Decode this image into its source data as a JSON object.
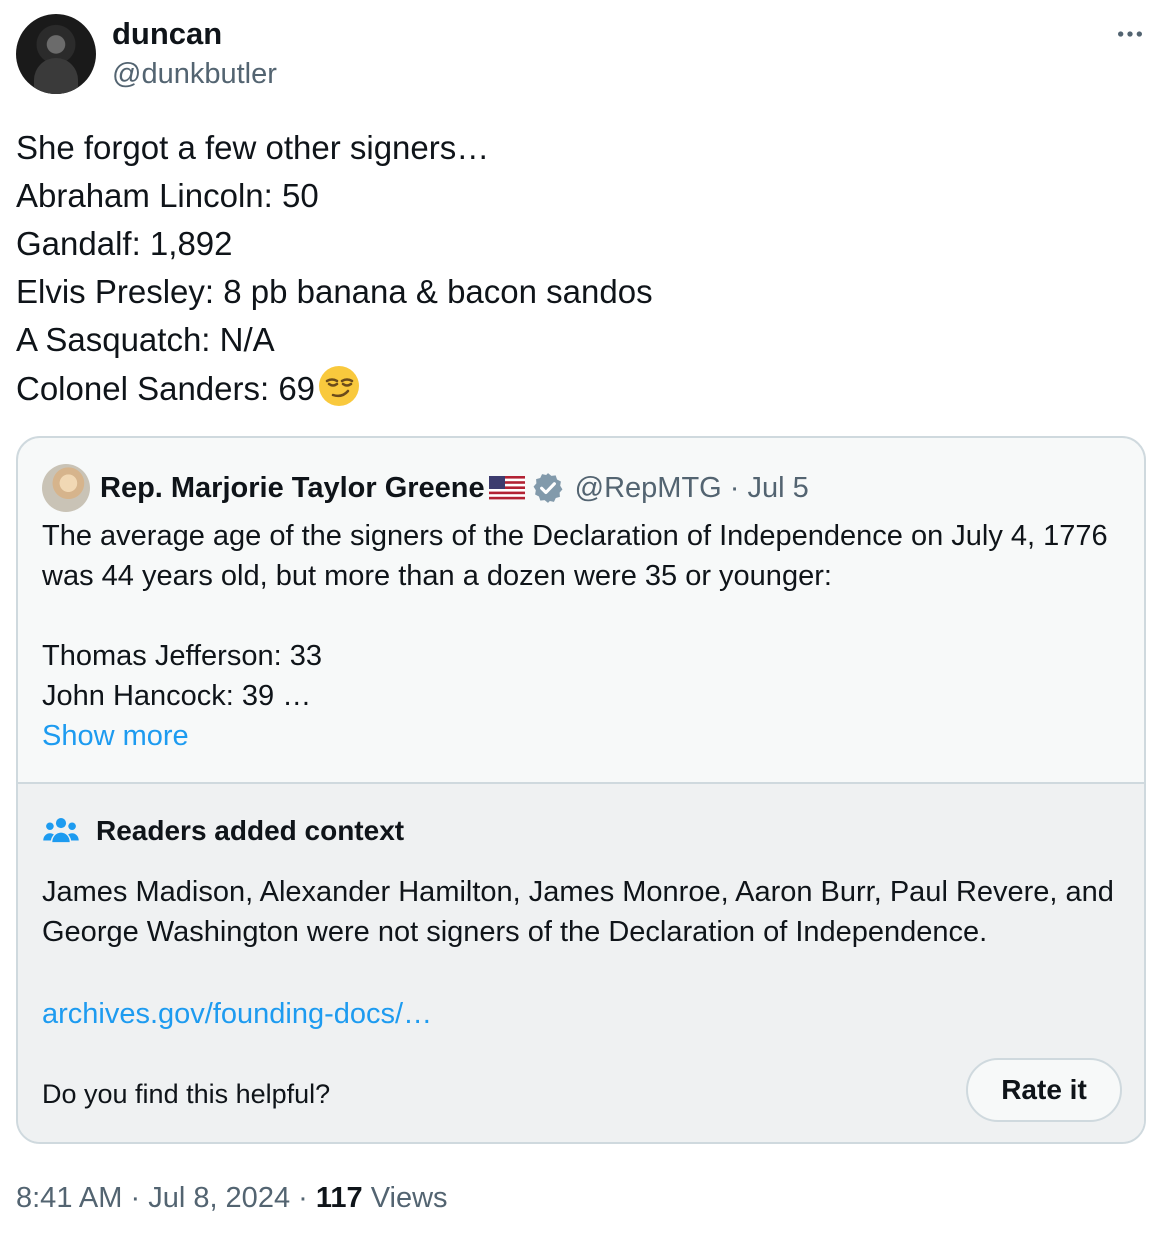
{
  "author": {
    "display_name": "duncan",
    "handle": "@dunkbutler"
  },
  "tweet": {
    "lines": [
      "She forgot a few other signers…",
      "Abraham Lincoln: 50",
      "Gandalf: 1,892",
      "Elvis Presley: 8 pb banana & bacon sandos",
      "A Sasquatch: N/A",
      "Colonel Sanders: 69"
    ],
    "emoji_icon": "smirking-face-emoji"
  },
  "quote": {
    "display_name": "Rep. Marjorie Taylor Greene",
    "flag_icon": "us-flag-emoji",
    "verified_icon": "verified-badge-icon",
    "handle": "@RepMTG",
    "separator": "·",
    "date": "Jul 5",
    "body_p1": "The average age of the signers of the Declaration of Independence on July 4, 1776 was 44 years old, but more than a dozen were 35 or younger:",
    "body_lines": [
      "Thomas Jefferson: 33",
      "John Hancock: 39 …"
    ],
    "show_more": "Show more"
  },
  "community_note": {
    "icon": "people-icon",
    "title": "Readers added context",
    "body": "James Madison, Alexander Hamilton, James Monroe, Aaron Burr, Paul Revere, and George Washington were not signers of the Declaration of Independence.",
    "link": "archives.gov/founding-docs/…",
    "question": "Do you find this helpful?",
    "rate_label": "Rate it"
  },
  "footer": {
    "time": "8:41 AM",
    "sep1": " · ",
    "date": "Jul 8, 2024",
    "sep2": " · ",
    "views_count": "117",
    "views_label": " Views"
  },
  "colors": {
    "accent": "#1d9bf0",
    "text": "#0f1419",
    "muted": "#536471",
    "border": "#cfd9de",
    "verified": "#829aab"
  }
}
